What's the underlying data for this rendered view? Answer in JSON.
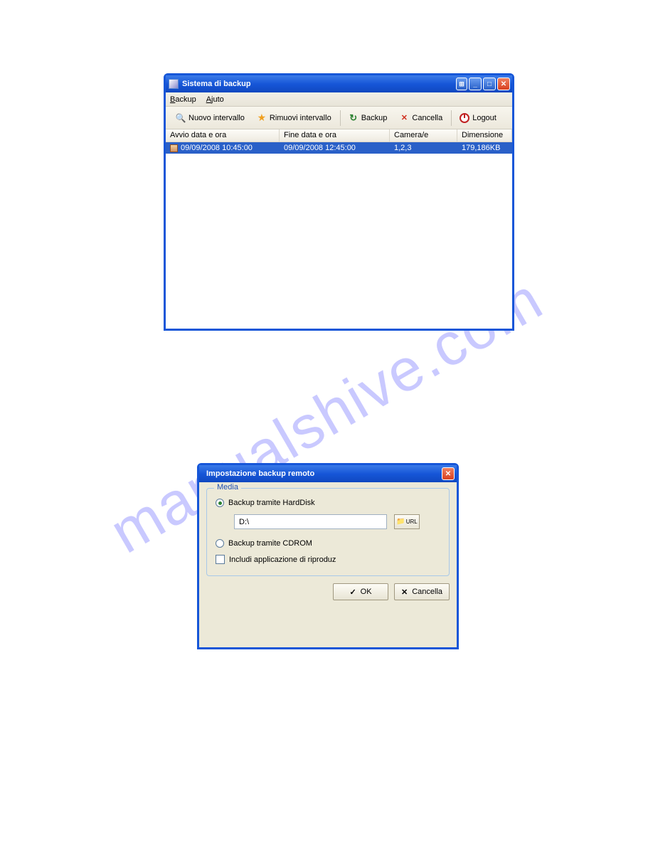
{
  "watermark": "manualshive.com",
  "window1": {
    "title": "Sistema di backup",
    "menus": {
      "backup": "Backup",
      "help": "Ajuto"
    },
    "toolbar": {
      "new_interval": "Nuovo intervallo",
      "remove_interval": "Rimuovi intervallo",
      "backup": "Backup",
      "cancel": "Cancella",
      "logout": "Logout"
    },
    "columns": {
      "start": "Avvio data e ora",
      "end": "Fine data e ora",
      "camera": "Camera/e",
      "size": "Dimensione"
    },
    "rows": [
      {
        "start": "09/09/2008 10:45:00",
        "end": "09/09/2008 12:45:00",
        "camera": "1,2,3",
        "size": "179,186KB"
      }
    ]
  },
  "window2": {
    "title": "Impostazione backup remoto",
    "group_label": "Media",
    "radio_hd": "Backup tramite HardDisk",
    "path_value": "D:\\",
    "browse_label": "URL",
    "radio_cd": "Backup tramite CDROM",
    "include_player": "Includi applicazione di riproduz",
    "ok": "OK",
    "cancel": "Cancella"
  }
}
